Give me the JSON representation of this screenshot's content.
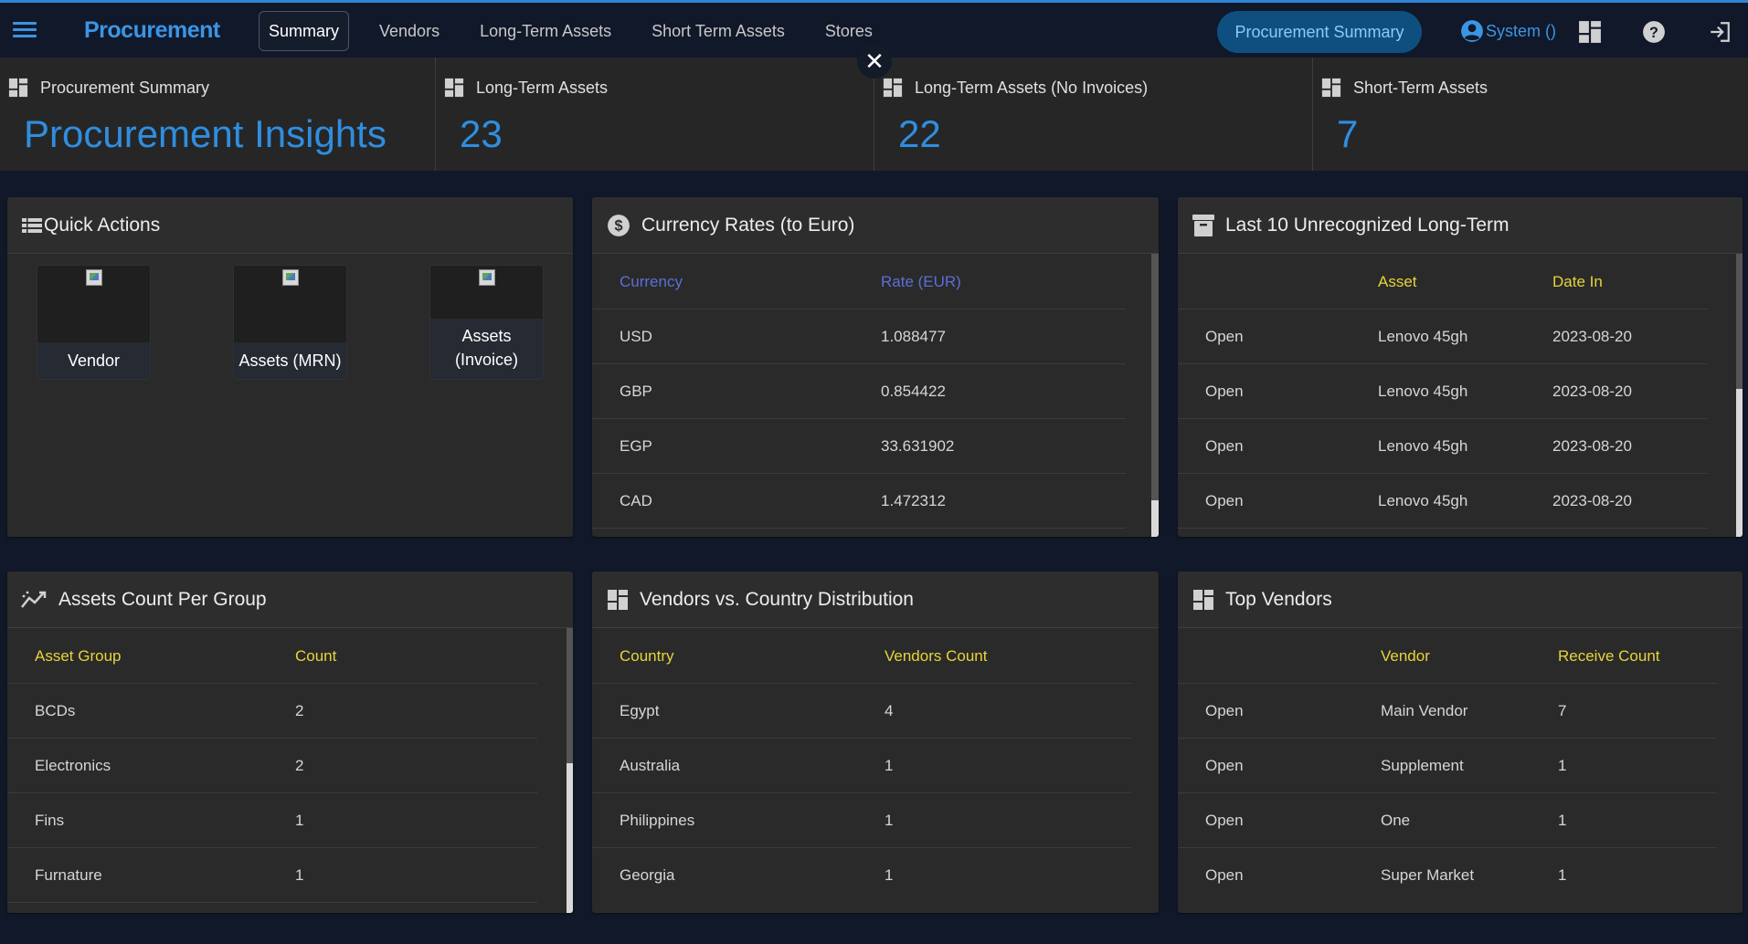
{
  "app": {
    "brand": "Procurement",
    "nav_tabs": [
      {
        "label": "Summary",
        "active": true
      },
      {
        "label": "Vendors"
      },
      {
        "label": "Long-Term Assets"
      },
      {
        "label": "Short Term Assets"
      },
      {
        "label": "Stores"
      }
    ],
    "summary_pill": "Procurement Summary",
    "user_label": "System ()",
    "accent_color": "#3b95e5"
  },
  "stats": [
    {
      "title": "Procurement Summary",
      "value": "Procurement Insights"
    },
    {
      "title": "Long-Term Assets",
      "value": "23"
    },
    {
      "title": "Long-Term Assets (No Invoices)",
      "value": "22"
    },
    {
      "title": "Short-Term Assets",
      "value": "7"
    }
  ],
  "quick_actions": {
    "title": "Quick Actions",
    "items": [
      {
        "label": "Vendor"
      },
      {
        "label": "Assets (MRN)"
      },
      {
        "label": "Assets (Invoice)"
      }
    ]
  },
  "currency_rates": {
    "title": "Currency Rates (to Euro)",
    "headers": [
      "Currency",
      "Rate (EUR)"
    ],
    "rows": [
      [
        "USD",
        "1.088477"
      ],
      [
        "GBP",
        "0.854422"
      ],
      [
        "EGP",
        "33.631902"
      ],
      [
        "CAD",
        "1.472312"
      ]
    ]
  },
  "unrecognized": {
    "title": "Last 10 Unrecognized Long-Term",
    "headers": [
      "",
      "Asset",
      "Date In"
    ],
    "rows": [
      [
        "Open",
        "Lenovo 45gh",
        "2023-08-20"
      ],
      [
        "Open",
        "Lenovo 45gh",
        "2023-08-20"
      ],
      [
        "Open",
        "Lenovo 45gh",
        "2023-08-20"
      ],
      [
        "Open",
        "Lenovo 45gh",
        "2023-08-20"
      ]
    ]
  },
  "asset_groups": {
    "title": "Assets Count Per Group",
    "headers": [
      "Asset Group",
      "Count"
    ],
    "rows": [
      [
        "BCDs",
        "2"
      ],
      [
        "Electronics",
        "2"
      ],
      [
        "Fins",
        "1"
      ],
      [
        "Furnature",
        "1"
      ]
    ]
  },
  "vendor_country": {
    "title": "Vendors vs. Country Distribution",
    "headers": [
      "Country",
      "Vendors Count"
    ],
    "rows": [
      [
        "Egypt",
        "4"
      ],
      [
        "Australia",
        "1"
      ],
      [
        "Philippines",
        "1"
      ],
      [
        "Georgia",
        "1"
      ]
    ]
  },
  "top_vendors": {
    "title": "Top Vendors",
    "headers": [
      "",
      "Vendor",
      "Receive Count"
    ],
    "rows": [
      [
        "Open",
        "Main Vendor",
        "7"
      ],
      [
        "Open",
        "Supplement",
        "1"
      ],
      [
        "Open",
        "One",
        "1"
      ],
      [
        "Open",
        "Super Market",
        "1"
      ]
    ]
  }
}
